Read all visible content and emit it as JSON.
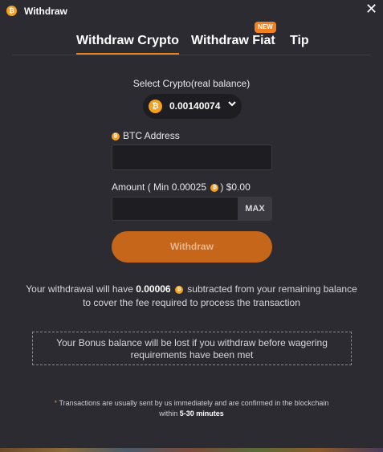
{
  "window": {
    "title": "Withdraw",
    "icon": "bitcoin-icon",
    "close_label": "✕"
  },
  "tabs": [
    {
      "label": "Withdraw Crypto",
      "active": true
    },
    {
      "label": "Withdraw Fiat",
      "badge": "NEW"
    },
    {
      "label": "Tip"
    }
  ],
  "crypto_select": {
    "label": "Select Crypto(real balance)",
    "value": "0.00140074",
    "icon": "bitcoin-icon"
  },
  "address": {
    "label": "BTC Address",
    "value": "",
    "placeholder": ""
  },
  "amount": {
    "label_prefix": "Amount ( Min 0.00025",
    "label_suffix": ") $0.00",
    "value": "",
    "placeholder": "",
    "max_label": "MAX"
  },
  "withdraw_button": "Withdraw",
  "fee_note": {
    "before": "Your withdrawal will have",
    "amount": "0.00006",
    "after": "subtracted from your remaining balance to cover the fee required to process the transaction"
  },
  "bonus_warning": "Your Bonus balance will be lost if you withdraw before wagering requirements have been met",
  "tx_note": {
    "star": "*",
    "text": "Transactions are usually sent by us immediately and are confirmed in the blockchain within",
    "time": "5-30 minutes"
  },
  "colors": {
    "accent": "#e8821a",
    "button": "#c5661a",
    "bitcoin": "#f5a020",
    "background": "#2d2b32"
  }
}
